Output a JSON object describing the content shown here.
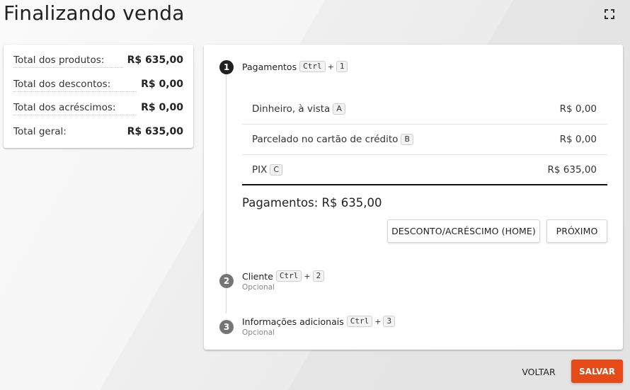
{
  "page": {
    "title": "Finalizando venda"
  },
  "summary": {
    "rows": [
      {
        "label": "Total dos produtos:",
        "value": "R$ 635,00"
      },
      {
        "label": "Total dos descontos:",
        "value": "R$ 0,00"
      },
      {
        "label": "Total dos acréscimos:",
        "value": "R$ 0,00"
      },
      {
        "label": "Total geral:",
        "value": "R$ 635,00"
      }
    ]
  },
  "steps": [
    {
      "number": "1",
      "title": "Pagamentos",
      "shortcut": [
        "Ctrl",
        "+",
        "1"
      ],
      "subtitle": ""
    },
    {
      "number": "2",
      "title": "Cliente",
      "shortcut": [
        "Ctrl",
        "+",
        "2"
      ],
      "subtitle": "Opcional"
    },
    {
      "number": "3",
      "title": "Informações adicionais",
      "shortcut": [
        "Ctrl",
        "+",
        "3"
      ],
      "subtitle": "Opcional"
    }
  ],
  "payment": {
    "methods": [
      {
        "label": "Dinheiro, à vista",
        "key": "A",
        "value": "R$ 0,00"
      },
      {
        "label": "Parcelado no cartão de crédito",
        "key": "B",
        "value": "R$ 0,00"
      },
      {
        "label": "PIX",
        "key": "C",
        "value": "R$ 635,00"
      }
    ],
    "total_label": "Pagamentos: R$ 635,00",
    "discount_button": "DESCONTO/ACRÉSCIMO (HOME)",
    "next_button": "PRÓXIMO"
  },
  "footer": {
    "back_button": "VOLTAR",
    "save_button": "SALVAR"
  },
  "colors": {
    "accent": "#e64a19",
    "step_active": "#212121",
    "step_inactive": "#757575"
  },
  "icons": {
    "fullscreen": "fullscreen-icon"
  }
}
